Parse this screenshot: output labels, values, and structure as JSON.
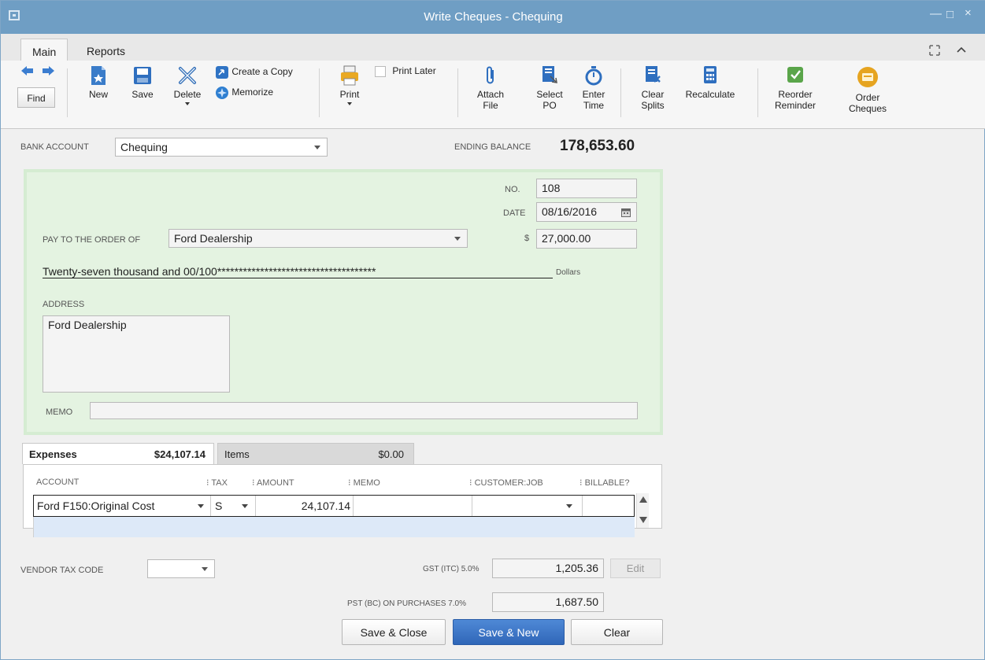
{
  "window": {
    "title": "Write Cheques - Chequing"
  },
  "ribbon_tabs": [
    {
      "label": "Main"
    },
    {
      "label": "Reports"
    }
  ],
  "toolbar": {
    "find": "Find",
    "new": "New",
    "save": "Save",
    "delete": "Delete",
    "create_copy": "Create a Copy",
    "memorize": "Memorize",
    "print": "Print",
    "print_later": "Print Later",
    "attach_file": [
      "Attach",
      "File"
    ],
    "select_po": [
      "Select",
      "PO"
    ],
    "enter_time": [
      "Enter",
      "Time"
    ],
    "clear_splits": [
      "Clear",
      "Splits"
    ],
    "recalculate": "Recalculate",
    "reorder_reminder": [
      "Reorder",
      "Reminder"
    ],
    "order_cheques": [
      "Order",
      "Cheques"
    ]
  },
  "bank": {
    "label": "BANK ACCOUNT",
    "value": "Chequing",
    "ending_balance_label": "ENDING BALANCE",
    "ending_balance": "178,653.60"
  },
  "cheque": {
    "no_label": "NO.",
    "no": "108",
    "date_label": "DATE",
    "date": "08/16/2016",
    "payee_label": "PAY TO THE ORDER OF",
    "payee": "Ford Dealership",
    "currency_label": "$",
    "amount": "27,000.00",
    "amount_words": "Twenty-seven thousand  and 00/100*************************************",
    "dollars_label": "Dollars",
    "address_label": "ADDRESS",
    "address": "Ford Dealership",
    "memo_label": "MEMO",
    "memo": ""
  },
  "tabs": {
    "expenses_label": "Expenses",
    "expenses_total": "$24,107.14",
    "items_label": "Items",
    "items_total": "$0.00"
  },
  "grid": {
    "headers": [
      "ACCOUNT",
      "TAX",
      "AMOUNT",
      "MEMO",
      "CUSTOMER:JOB",
      "BILLABLE?"
    ],
    "rows": [
      {
        "account": "Ford F150:Original Cost",
        "tax": "S",
        "amount": "24,107.14",
        "memo": "",
        "customer_job": "",
        "billable": ""
      }
    ]
  },
  "footer": {
    "vendor_tax_code_label": "VENDOR TAX CODE",
    "vendor_tax_code": "",
    "gst_label": "GST (ITC) 5.0%",
    "gst": "1,205.36",
    "edit": "Edit",
    "pst_label": "PST (BC) ON PURCHASES 7.0%",
    "pst": "1,687.50"
  },
  "buttons": {
    "save_close": "Save & Close",
    "save_new": "Save & New",
    "clear": "Clear"
  },
  "colors": {
    "titlebar": "#6f9ec4",
    "cheque_bg": "#e4f3e1",
    "primary_button": "#2f66b8"
  }
}
